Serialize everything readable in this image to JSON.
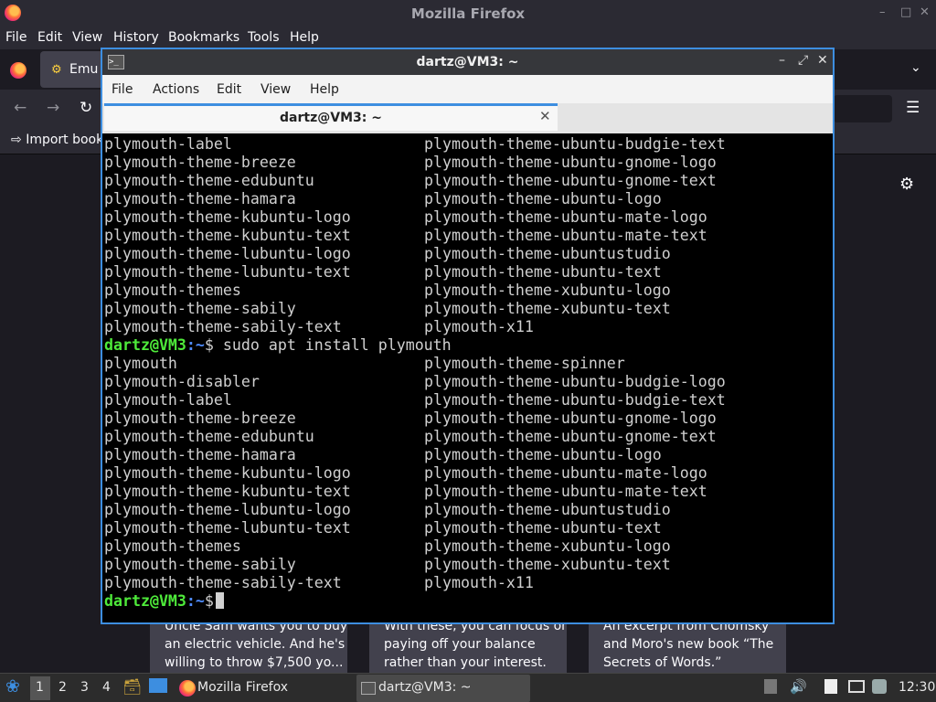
{
  "firefox": {
    "title": "Mozilla Firefox",
    "menu": [
      "File",
      "Edit",
      "View",
      "History",
      "Bookmarks",
      "Tools",
      "Help"
    ],
    "tab_label": "Emu",
    "bookmark": "Import book",
    "cards": [
      {
        "line1": "Uncle Sam wants you to buy",
        "line2": "an electric vehicle. And he's",
        "line3": "willing to throw $7,500 yo..."
      },
      {
        "line1": "With these, you can focus on",
        "line2": "paying off your balance",
        "line3": "rather than your interest."
      },
      {
        "line1": "An excerpt from Chomsky",
        "line2": "and Moro's new book “The",
        "line3": "Secrets of Words.”"
      }
    ]
  },
  "terminal": {
    "title": "dartz@VM3: ~",
    "menu": [
      "File",
      "Actions",
      "Edit",
      "View",
      "Help"
    ],
    "tab_title": "dartz@VM3: ~",
    "prompt_user": "dartz@VM3",
    "prompt_path": ":~",
    "prompt_symbol": "$",
    "command": " sudo apt install plymouth",
    "block1": [
      [
        "plymouth-label",
        "plymouth-theme-ubuntu-budgie-text"
      ],
      [
        "plymouth-theme-breeze",
        "plymouth-theme-ubuntu-gnome-logo"
      ],
      [
        "plymouth-theme-edubuntu",
        "plymouth-theme-ubuntu-gnome-text"
      ],
      [
        "plymouth-theme-hamara",
        "plymouth-theme-ubuntu-logo"
      ],
      [
        "plymouth-theme-kubuntu-logo",
        "plymouth-theme-ubuntu-mate-logo"
      ],
      [
        "plymouth-theme-kubuntu-text",
        "plymouth-theme-ubuntu-mate-text"
      ],
      [
        "plymouth-theme-lubuntu-logo",
        "plymouth-theme-ubuntustudio"
      ],
      [
        "plymouth-theme-lubuntu-text",
        "plymouth-theme-ubuntu-text"
      ],
      [
        "plymouth-themes",
        "plymouth-theme-xubuntu-logo"
      ],
      [
        "plymouth-theme-sabily",
        "plymouth-theme-xubuntu-text"
      ],
      [
        "plymouth-theme-sabily-text",
        "plymouth-x11"
      ]
    ],
    "block2": [
      [
        "plymouth",
        "plymouth-theme-spinner"
      ],
      [
        "plymouth-disabler",
        "plymouth-theme-ubuntu-budgie-logo"
      ],
      [
        "plymouth-label",
        "plymouth-theme-ubuntu-budgie-text"
      ],
      [
        "plymouth-theme-breeze",
        "plymouth-theme-ubuntu-gnome-logo"
      ],
      [
        "plymouth-theme-edubuntu",
        "plymouth-theme-ubuntu-gnome-text"
      ],
      [
        "plymouth-theme-hamara",
        "plymouth-theme-ubuntu-logo"
      ],
      [
        "plymouth-theme-kubuntu-logo",
        "plymouth-theme-ubuntu-mate-logo"
      ],
      [
        "plymouth-theme-kubuntu-text",
        "plymouth-theme-ubuntu-mate-text"
      ],
      [
        "plymouth-theme-lubuntu-logo",
        "plymouth-theme-ubuntustudio"
      ],
      [
        "plymouth-theme-lubuntu-text",
        "plymouth-theme-ubuntu-text"
      ],
      [
        "plymouth-themes",
        "plymouth-theme-xubuntu-logo"
      ],
      [
        "plymouth-theme-sabily",
        "plymouth-theme-xubuntu-text"
      ],
      [
        "plymouth-theme-sabily-text",
        "plymouth-x11"
      ]
    ]
  },
  "taskbar": {
    "workspaces": [
      "1",
      "2",
      "3",
      "4"
    ],
    "firefox_label": "Mozilla Firefox",
    "terminal_label": "dartz@VM3: ~",
    "clock": "12:30"
  },
  "colors": {
    "prompt_user": "#4eea3a",
    "prompt_path": "#4f8cff",
    "accent": "#3d8ee0"
  }
}
